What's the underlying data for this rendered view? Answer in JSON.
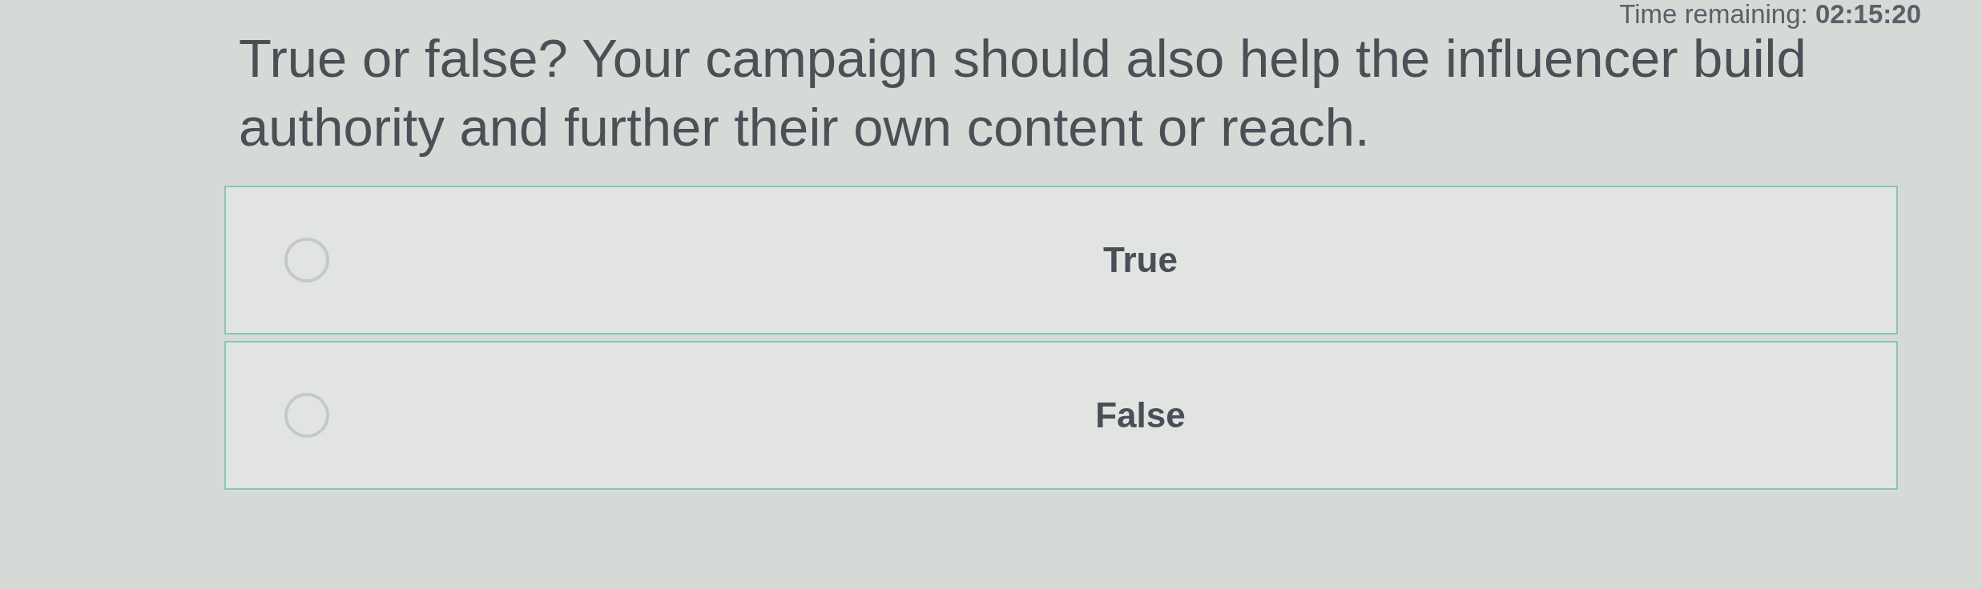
{
  "timer": {
    "text": "Time remaining: **02:15:20**"
  },
  "question": {
    "text": "True or false? Your campaign should also help the influencer build authority and further their own content or reach."
  },
  "options": [
    {
      "label": "True",
      "selected": false
    },
    {
      "label": "False",
      "selected": false
    }
  ]
}
